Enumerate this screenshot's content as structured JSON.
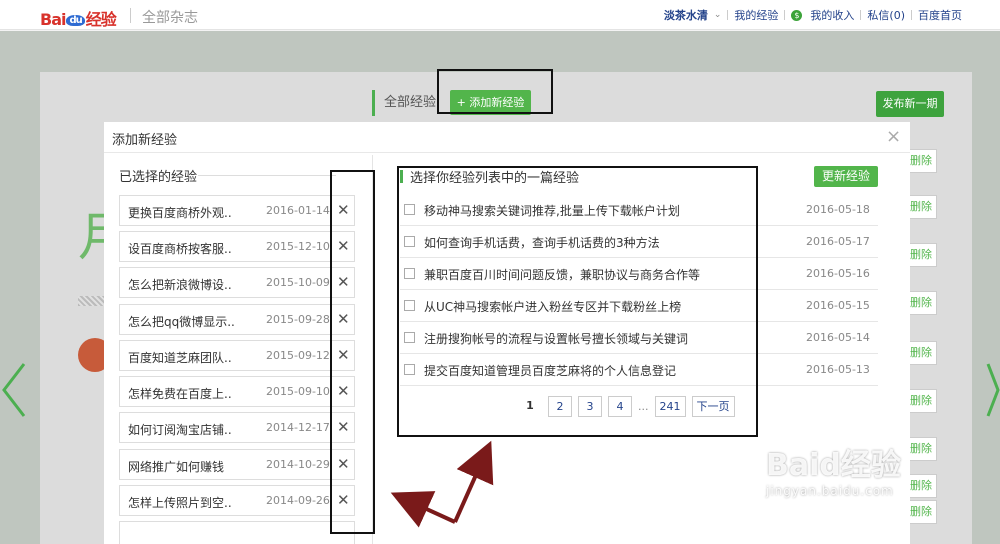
{
  "topbar": {
    "logo_prefix": "Bai",
    "logo_du": "du",
    "logo_suffix": "经验",
    "section_title": "全部杂志",
    "user_name": "淡茶水清",
    "links": [
      "我的经验",
      "我的收入",
      "私信(0)",
      "百度首页"
    ]
  },
  "background_page": {
    "tab_label": "全部经验",
    "add_button": "+ 添加新经验",
    "publish_button": "发布新一期",
    "big_char": "月",
    "delete_labels": [
      "删除",
      "删除",
      "删除",
      "删除",
      "删除",
      "删除",
      "删除",
      "删除",
      "删除"
    ]
  },
  "modal": {
    "title": "添加新经验",
    "close": "×",
    "left_title": "已选择的经验",
    "selected": [
      {
        "title": "更换百度商桥外观..",
        "date": "2016-01-14"
      },
      {
        "title": "设百度商桥按客服..",
        "date": "2015-12-10"
      },
      {
        "title": "怎么把新浪微博设..",
        "date": "2015-10-09"
      },
      {
        "title": "怎么把qq微博显示..",
        "date": "2015-09-28"
      },
      {
        "title": "百度知道芝麻团队..",
        "date": "2015-09-12"
      },
      {
        "title": "怎样免费在百度上..",
        "date": "2015-09-10"
      },
      {
        "title": "如何订阅淘宝店铺..",
        "date": "2014-12-17"
      },
      {
        "title": "网络推广如何赚钱",
        "date": "2014-10-29"
      },
      {
        "title": "怎样上传照片到空..",
        "date": "2014-09-26"
      }
    ],
    "remove_glyph": "✕",
    "right_title": "选择你经验列表中的一篇经验",
    "update_button": "更新经验",
    "articles": [
      {
        "title": "移动神马搜索关键词推荐,批量上传下载帐户计划",
        "date": "2016-05-18"
      },
      {
        "title": "如何查询手机话费，查询手机话费的3种方法",
        "date": "2016-05-17"
      },
      {
        "title": "兼职百度百川时间问题反馈，兼职协议与商务合作等",
        "date": "2016-05-16"
      },
      {
        "title": "从UC神马搜索帐户进入粉丝专区并下载粉丝上榜",
        "date": "2016-05-15"
      },
      {
        "title": "注册搜狗帐号的流程与设置帐号擅长领域与关键词",
        "date": "2016-05-14"
      },
      {
        "title": "提交百度知道管理员百度芝麻将的个人信息登记",
        "date": "2016-05-13"
      }
    ],
    "pager": {
      "current": "1",
      "pages": [
        "2",
        "3",
        "4"
      ],
      "ellipsis": "...",
      "last": "241",
      "next": "下一页"
    }
  },
  "watermark": {
    "main": "Baid经验",
    "sub": "jingyan.baidu.com"
  },
  "colors": {
    "accent_green": "#52b54b",
    "link_blue": "#24438b",
    "logo_red": "#d8322b",
    "annotation_arrow": "#7a1a1a"
  }
}
